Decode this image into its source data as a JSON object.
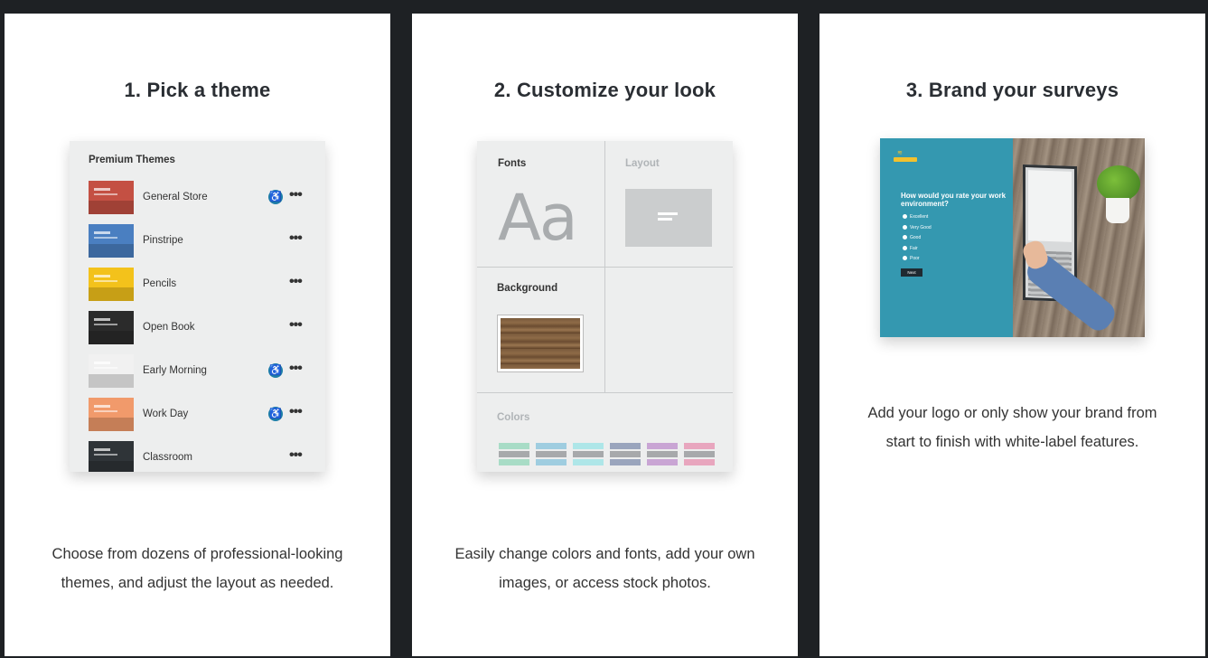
{
  "cards": [
    {
      "title": "1. Pick a theme",
      "description": "Choose from dozens of professional-looking themes, and adjust the layout as needed."
    },
    {
      "title": "2. Customize your look",
      "description": "Easily change colors and fonts, add your own images, or access stock photos."
    },
    {
      "title": "3. Brand your surveys",
      "description": "Add your logo or only show your brand from start to finish with white-label features."
    }
  ],
  "themes_panel": {
    "title": "Premium Themes",
    "items": [
      {
        "name": "General Store",
        "accessible": true,
        "color": "#c45043"
      },
      {
        "name": "Pinstripe",
        "accessible": false,
        "color": "#4a7fc1"
      },
      {
        "name": "Pencils",
        "accessible": false,
        "color": "#f3c21b"
      },
      {
        "name": "Open Book",
        "accessible": false,
        "color": "#2b2b2b"
      },
      {
        "name": "Early Morning",
        "accessible": true,
        "color": "#f1f1f1"
      },
      {
        "name": "Work Day",
        "accessible": true,
        "color": "#f19a6b"
      },
      {
        "name": "Classroom",
        "accessible": false,
        "color": "#2f3438"
      }
    ],
    "more_label": "•••",
    "accessibility_glyph": "♿"
  },
  "customize_panel": {
    "fonts_label": "Fonts",
    "fonts_sample": "Aa",
    "layout_label": "Layout",
    "background_label": "Background",
    "colors_label": "Colors",
    "swatches": [
      [
        "#a8dcc6",
        "#a7a9ab",
        "#a8dcc6"
      ],
      [
        "#9fcde0",
        "#a7a9ab",
        "#9fcde0"
      ],
      [
        "#aee6e8",
        "#a7a9ab",
        "#aee6e8"
      ],
      [
        "#9aa5bd",
        "#a7a9ab",
        "#9aa5bd"
      ],
      [
        "#c9a5d4",
        "#a7a9ab",
        "#c9a5d4"
      ],
      [
        "#e8a6be",
        "#a7a9ab",
        "#e8a6be"
      ]
    ]
  },
  "brand_panel": {
    "question": "How would you rate your work environment?",
    "options": [
      "Excellent",
      "Very Good",
      "Good",
      "Fair",
      "Poor"
    ],
    "next_label": "Next",
    "accent": "#3498b0"
  }
}
